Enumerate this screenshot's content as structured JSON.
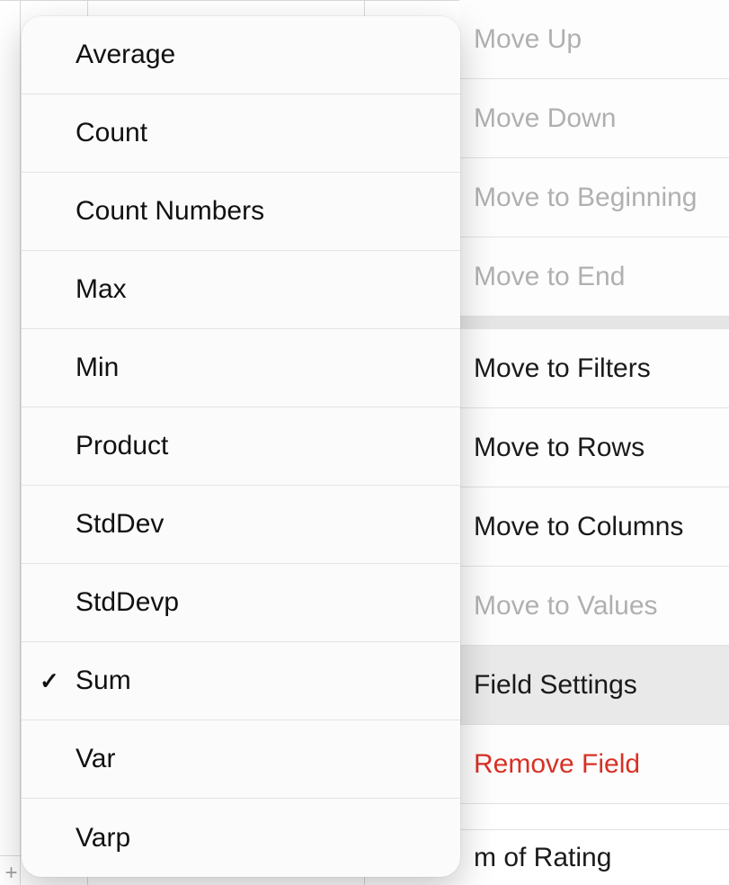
{
  "context_menu": {
    "items": [
      {
        "id": "move-up",
        "label": "Move Up",
        "disabled": true,
        "highlight": false
      },
      {
        "id": "move-down",
        "label": "Move Down",
        "disabled": true,
        "highlight": false
      },
      {
        "id": "move-beginning",
        "label": "Move to Beginning",
        "disabled": true,
        "highlight": false
      },
      {
        "id": "move-end",
        "label": "Move to End",
        "disabled": true,
        "highlight": false
      },
      {
        "id": "sep1",
        "separator": true
      },
      {
        "id": "move-filters",
        "label": "Move to Filters",
        "disabled": false,
        "highlight": false
      },
      {
        "id": "move-rows",
        "label": "Move to Rows",
        "disabled": false,
        "highlight": false
      },
      {
        "id": "move-columns",
        "label": "Move to Columns",
        "disabled": false,
        "highlight": false
      },
      {
        "id": "move-values",
        "label": "Move to Values",
        "disabled": true,
        "highlight": false
      },
      {
        "id": "field-settings",
        "label": "Field Settings",
        "disabled": false,
        "highlight": true
      },
      {
        "id": "remove-field",
        "label": "Remove Field",
        "disabled": false,
        "highlight": false,
        "danger": true
      }
    ],
    "bottom_partial_label": "m of Rating"
  },
  "popup": {
    "items": [
      {
        "id": "average",
        "label": "Average",
        "checked": false
      },
      {
        "id": "count",
        "label": "Count",
        "checked": false
      },
      {
        "id": "count-numbers",
        "label": "Count Numbers",
        "checked": false
      },
      {
        "id": "max",
        "label": "Max",
        "checked": false
      },
      {
        "id": "min",
        "label": "Min",
        "checked": false
      },
      {
        "id": "product",
        "label": "Product",
        "checked": false
      },
      {
        "id": "stddev",
        "label": "StdDev",
        "checked": false
      },
      {
        "id": "stddevp",
        "label": "StdDevp",
        "checked": false
      },
      {
        "id": "sum",
        "label": "Sum",
        "checked": true
      },
      {
        "id": "var",
        "label": "Var",
        "checked": false
      },
      {
        "id": "varp",
        "label": "Varp",
        "checked": false
      }
    ],
    "check_mark": "✓"
  }
}
